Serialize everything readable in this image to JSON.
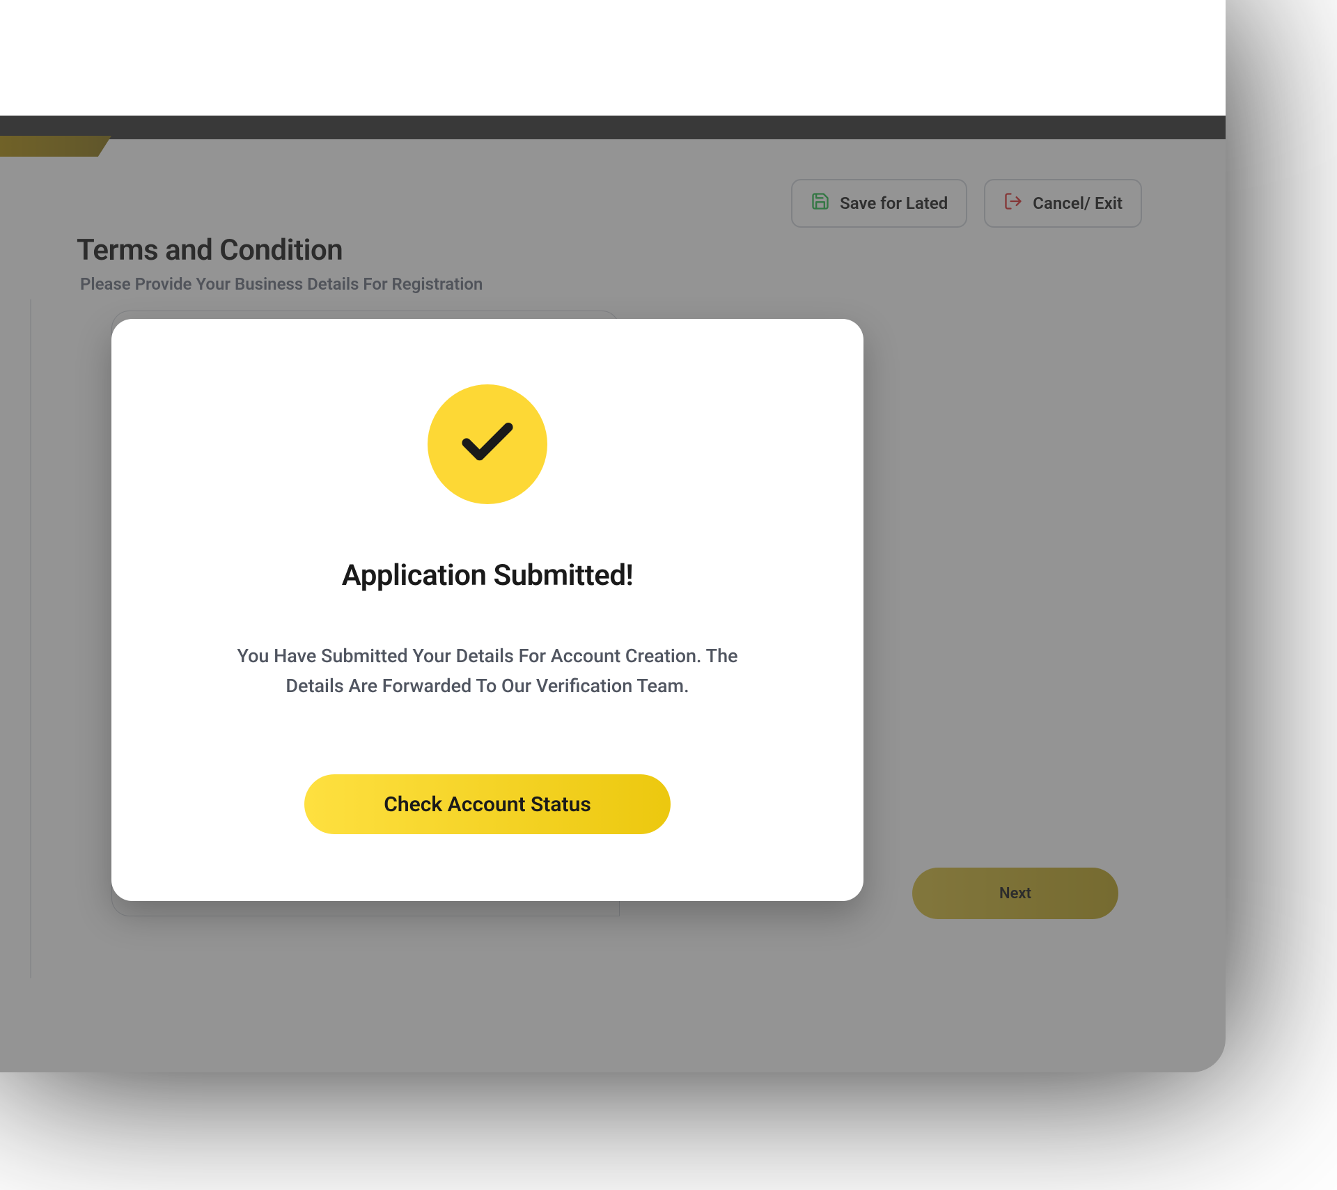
{
  "header": {
    "save_label": "Save for Lated",
    "cancel_label": "Cancel/ Exit"
  },
  "page": {
    "title": "Terms and Condition",
    "subtitle": "Please Provide Your Business Details For Registration",
    "next_label": "Next"
  },
  "modal": {
    "title": "Application Submitted!",
    "description_line1": "You Have Submitted Your Details For Account Creation. The",
    "description_line2": "Details Are Forwarded To Our Verification Team.",
    "cta_label": "Check Account Status"
  },
  "icons": {
    "save": "save-icon",
    "exit": "exit-icon",
    "check": "check-icon"
  },
  "colors": {
    "primary_yellow": "#fdd835",
    "gradient_start": "#fee040",
    "gradient_end": "#ecc80f"
  }
}
